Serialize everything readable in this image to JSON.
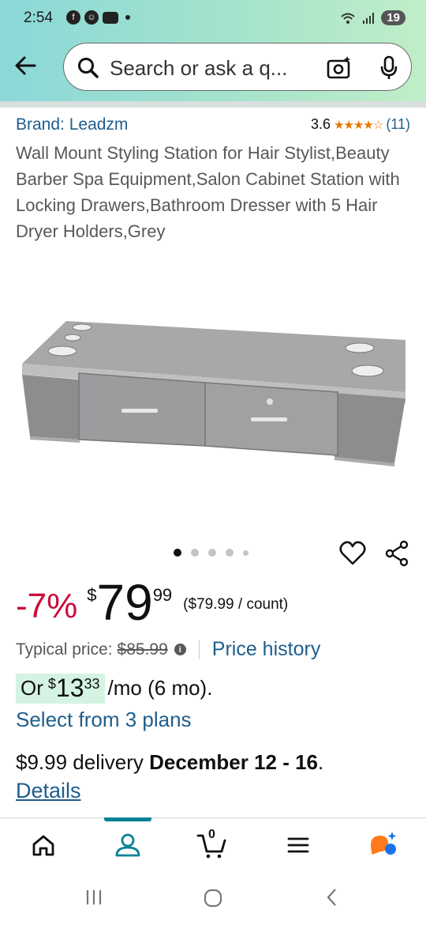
{
  "status_bar": {
    "time": "2:54",
    "battery": "19"
  },
  "search": {
    "placeholder": "Search or ask a q..."
  },
  "product": {
    "brand": "Brand: Leadzm",
    "rating": "3.6",
    "stars": "★★★★☆",
    "review_count": "(11)",
    "title": "Wall Mount Styling Station for Hair Stylist,Beauty Barber Spa Equipment,Salon Cabinet Station with Locking Drawers,Bathroom Dresser with 5 Hair Dryer Holders,Grey",
    "image_index": 1,
    "image_count": 5
  },
  "price": {
    "discount": "-7%",
    "currency": "$",
    "whole": "79",
    "fraction": "99",
    "unit_price": "($79.99 / count)",
    "typical_label": "Typical price:",
    "typical_value": "$85.99",
    "history_link": "Price history"
  },
  "installment": {
    "prefix": "Or",
    "currency": "$",
    "whole": "13",
    "fraction": "33",
    "suffix": "/mo (6 mo).",
    "plans_link": "Select from 3 plans"
  },
  "delivery": {
    "text": "$9.99 delivery ",
    "dates": "December 12 - 16",
    "period": ".",
    "details_link": "Details"
  },
  "nav": {
    "cart_count": "0",
    "active": "account"
  },
  "colors": {
    "link": "#1f5e8c",
    "discount": "#cc0c39",
    "star": "#e77600",
    "installment_bg": "#d5f3e2",
    "active_tab": "#008296"
  }
}
